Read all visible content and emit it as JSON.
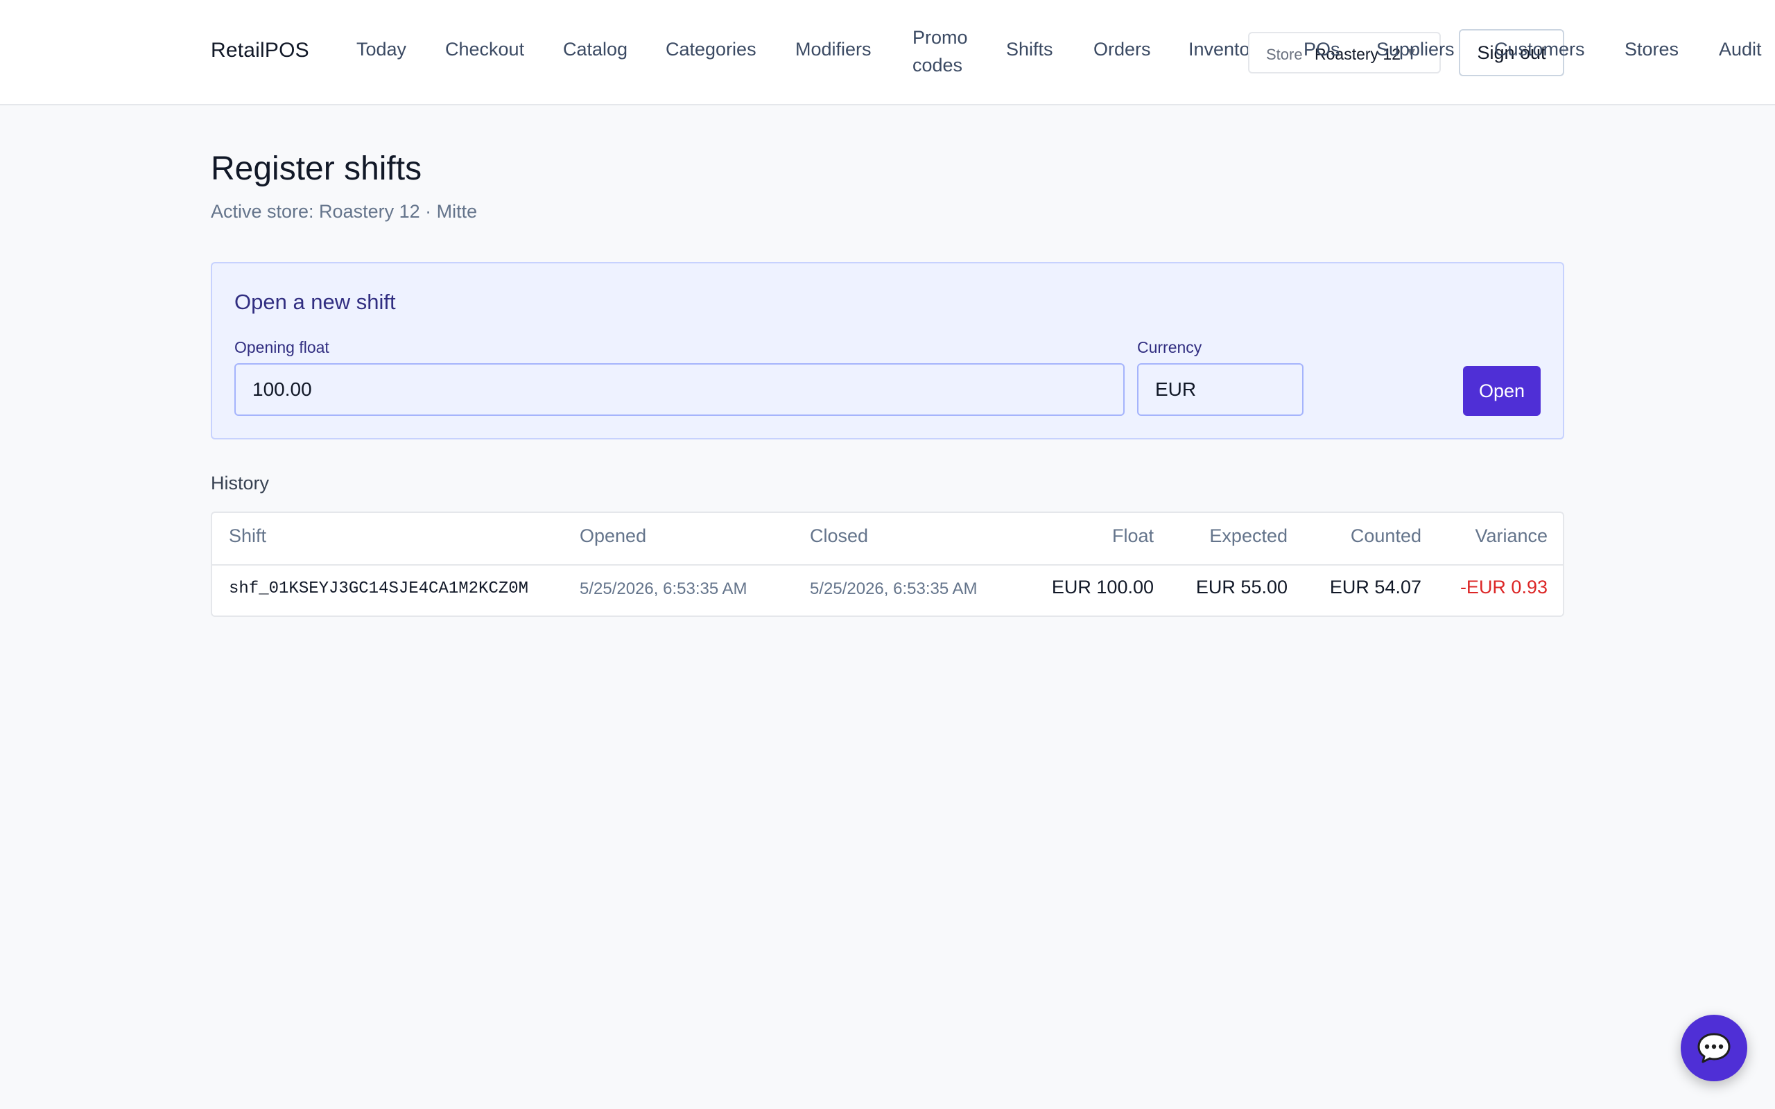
{
  "app": {
    "brand": "RetailPOS"
  },
  "nav": [
    {
      "label": "Today"
    },
    {
      "label": "Checkout"
    },
    {
      "label": "Catalog"
    },
    {
      "label": "Categories"
    },
    {
      "label": "Modifiers"
    },
    {
      "label": "Promo codes"
    },
    {
      "label": "Shifts"
    },
    {
      "label": "Orders"
    },
    {
      "label": "Inventory"
    },
    {
      "label": "POs"
    },
    {
      "label": "Suppliers"
    },
    {
      "label": "Customers"
    },
    {
      "label": "Stores"
    },
    {
      "label": "Audit"
    }
  ],
  "store_select": {
    "label": "Store",
    "value": "Roastery 12"
  },
  "signout_label": "Sign out",
  "page": {
    "title": "Register shifts",
    "subtitle": "Active store: Roastery 12 · Mitte"
  },
  "open_shift": {
    "title": "Open a new shift",
    "float_label": "Opening float",
    "float_value": "100.00",
    "currency_label": "Currency",
    "currency_value": "EUR",
    "button_label": "Open"
  },
  "history": {
    "title": "History",
    "columns": [
      "Shift",
      "Opened",
      "Closed",
      "Float",
      "Expected",
      "Counted",
      "Variance"
    ],
    "rows": [
      {
        "shift": "shf_01KSEYJ3GC14SJE4CA1M2KCZ0M",
        "opened": "5/25/2026, 6:53:35 AM",
        "closed": "5/25/2026, 6:53:35 AM",
        "float": "EUR 100.00",
        "expected": "EUR 55.00",
        "counted": "EUR 54.07",
        "variance": "-EUR 0.93"
      }
    ]
  },
  "colors": {
    "accent": "#4f2fd6",
    "negative": "#dc2626",
    "card_bg": "#eef2ff"
  },
  "icons": {
    "chat": "chat-bubble-icon",
    "store_chevron": "chevron-down-icon"
  }
}
